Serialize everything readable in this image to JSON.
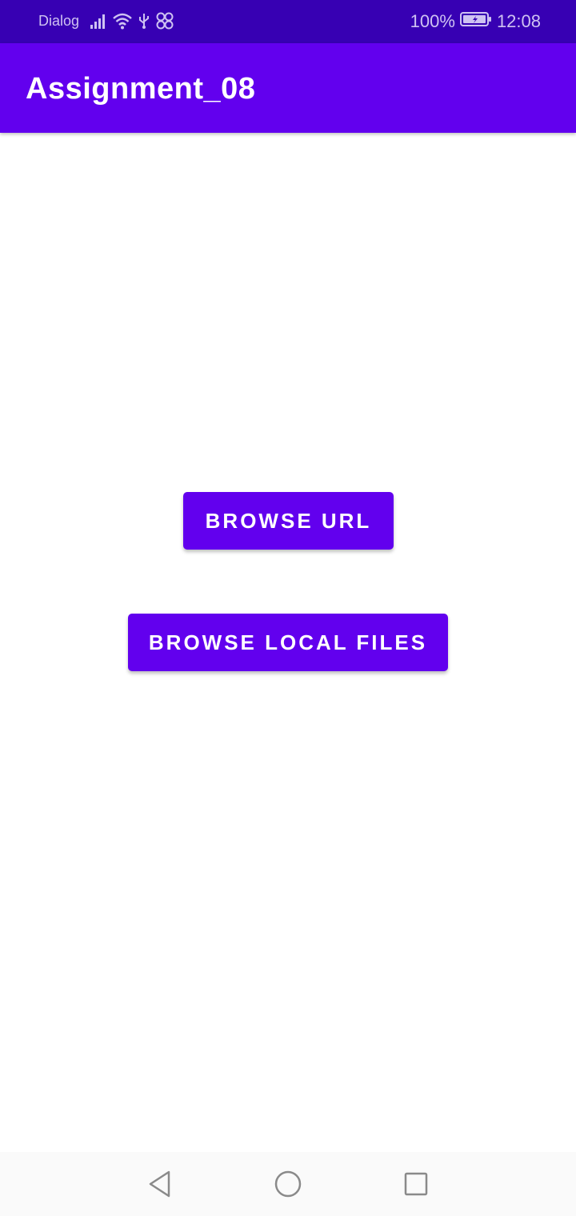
{
  "status_bar": {
    "carrier": "Dialog",
    "battery": "100%",
    "time": "12:08",
    "icons": [
      "signal-icon",
      "wifi-icon",
      "usb-icon",
      "nfc-icon",
      "battery-charging-icon"
    ]
  },
  "app_bar": {
    "title": "Assignment_08"
  },
  "main": {
    "browse_url_label": "BROWSE URL",
    "browse_local_label": "BROWSE LOCAL FILES"
  },
  "nav_bar": {
    "icons": [
      "back-icon",
      "home-icon",
      "recents-icon"
    ]
  },
  "colors": {
    "primary": "#6200ee",
    "primary_dark": "#3700b3",
    "on_primary": "#ffffff",
    "background": "#ffffff"
  }
}
